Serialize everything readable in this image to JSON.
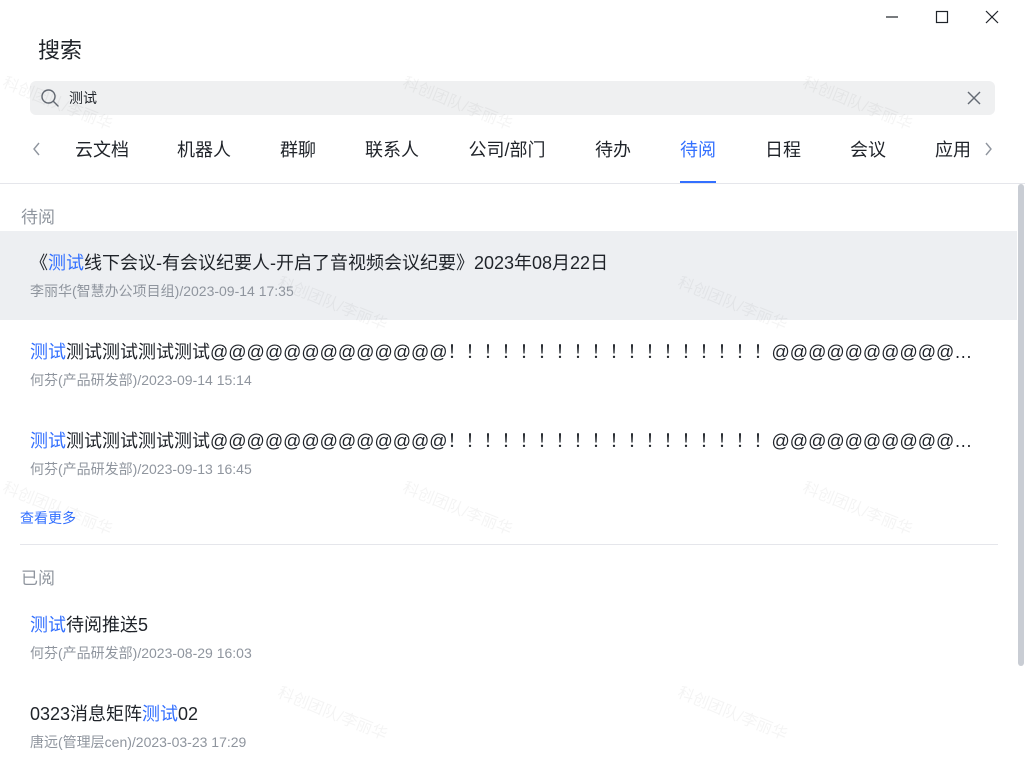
{
  "window": {
    "title": "搜索"
  },
  "search": {
    "value": "测试"
  },
  "tabs": [
    {
      "label": "云文档",
      "active": false
    },
    {
      "label": "机器人",
      "active": false
    },
    {
      "label": "群聊",
      "active": false
    },
    {
      "label": "联系人",
      "active": false
    },
    {
      "label": "公司/部门",
      "active": false
    },
    {
      "label": "待办",
      "active": false
    },
    {
      "label": "待阅",
      "active": true
    },
    {
      "label": "日程",
      "active": false
    },
    {
      "label": "会议",
      "active": false
    },
    {
      "label": "应用",
      "active": false
    }
  ],
  "sections": [
    {
      "label": "待阅",
      "items": [
        {
          "title_pre": "《",
          "title_kw": "测试",
          "title_post": "线下会议-有会议纪要人-开启了音视频会议纪要》2023年08月22日",
          "meta": "李丽华(智慧办公项目组)/2023-09-14 17:35",
          "highlighted": true
        },
        {
          "title_pre": "",
          "title_kw": "测试",
          "title_post": "测试测试测试测试@@@@@@@@@@@@@！！！！！！！！！！！！！！！！！！@@@@@@@@@@@@@@@@@@",
          "meta": "何芬(产品研发部)/2023-09-14 15:14",
          "highlighted": false
        },
        {
          "title_pre": "",
          "title_kw": "测试",
          "title_post": "测试测试测试测试@@@@@@@@@@@@@！！！！！！！！！！！！！！！！！！@@@@@@@@@@@@@@@@@@",
          "meta": "何芬(产品研发部)/2023-09-13 16:45",
          "highlighted": false
        }
      ],
      "see_more": "查看更多"
    },
    {
      "label": "已阅",
      "items": [
        {
          "title_pre": "",
          "title_kw": "测试",
          "title_post": "待阅推送5",
          "meta": "何芬(产品研发部)/2023-08-29 16:03",
          "highlighted": false
        },
        {
          "title_pre": "0323消息矩阵",
          "title_kw": "测试",
          "title_post": "02",
          "meta": "唐远(管理层cen)/2023-03-23 17:29",
          "highlighted": false
        }
      ]
    }
  ],
  "watermark": "科创团队/李丽华",
  "colors": {
    "accent": "#3370ff",
    "muted": "#8f959e",
    "highlight_bg": "#edeff2"
  }
}
